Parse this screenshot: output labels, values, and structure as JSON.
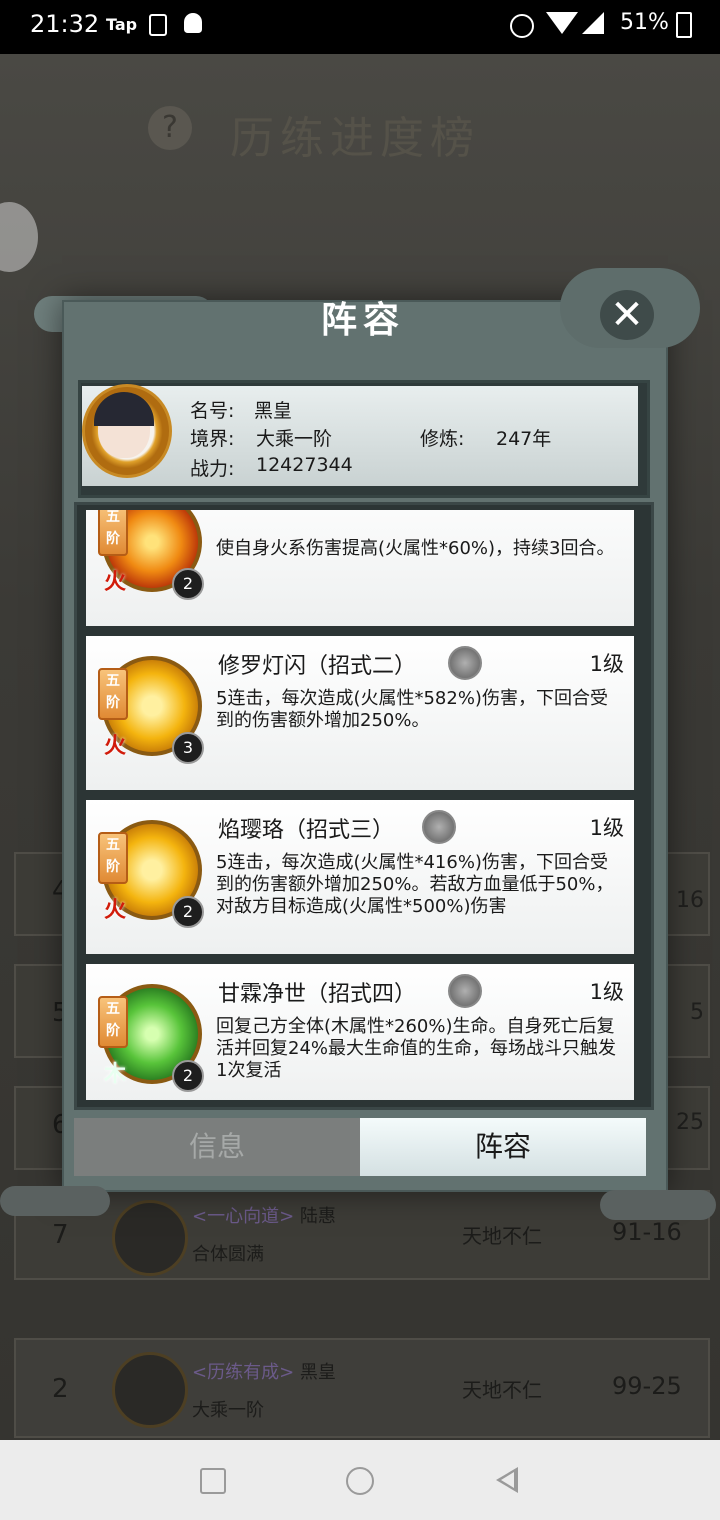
{
  "status_bar": {
    "time": "21:32",
    "tap_label": "Tap",
    "battery": "51%"
  },
  "background": {
    "title": "历练进度榜",
    "help": "?",
    "rows": [
      {
        "rank": "4",
        "progress": "16"
      },
      {
        "rank": "5",
        "progress": "5"
      },
      {
        "rank": "6",
        "progress": "25"
      },
      {
        "rank": "7",
        "name_tag": "<一心向道>",
        "name": "陆惠",
        "realm": "合体圆满",
        "difficulty": "天地不仁",
        "progress": "91-16"
      },
      {
        "rank": "2",
        "name_tag": "<历练有成>",
        "name": "黑皇",
        "realm": "大乘一阶",
        "difficulty": "天地不仁",
        "progress": "99-25"
      }
    ]
  },
  "modal": {
    "title": "阵容",
    "close": "✕",
    "player": {
      "name_label": "名号:",
      "name": "黑皇",
      "realm_label": "境界:",
      "realm": "大乘一阶",
      "cultivation_label": "修炼:",
      "cultivation": "247年",
      "power_label": "战力:",
      "power": "12427344"
    },
    "skills": [
      {
        "name": "",
        "level": "",
        "tier": "五阶",
        "element": "火",
        "count": "2",
        "desc": "使自身火系伤害提高(火属性*60%)，持续3回合。"
      },
      {
        "name": "修罗灯闪（招式二）",
        "level": "1级",
        "tier": "五阶",
        "element": "火",
        "count": "3",
        "desc": "5连击，每次造成(火属性*582%)伤害，下回合受到的伤害额外增加250%。"
      },
      {
        "name": "焰璎珞（招式三）",
        "level": "1级",
        "tier": "五阶",
        "element": "火",
        "count": "2",
        "desc": "5连击，每次造成(火属性*416%)伤害，下回合受到的伤害额外增加250%。若敌方血量低于50%，对敌方目标造成(火属性*500%)伤害"
      },
      {
        "name": "甘霖净世（招式四）",
        "level": "1级",
        "tier": "五阶",
        "element": "木",
        "count": "2",
        "desc": "回复己方全体(木属性*260%)生命。自身死亡后复活并回复24%最大生命值的生命，每场战斗只触发1次复活"
      }
    ],
    "tabs": {
      "info": "信息",
      "lineup": "阵容"
    }
  },
  "colors": {
    "modal_bg": "#627270",
    "tab_active_bg": "#e6eff0",
    "tab_inactive_bg": "#7b7e7d"
  }
}
